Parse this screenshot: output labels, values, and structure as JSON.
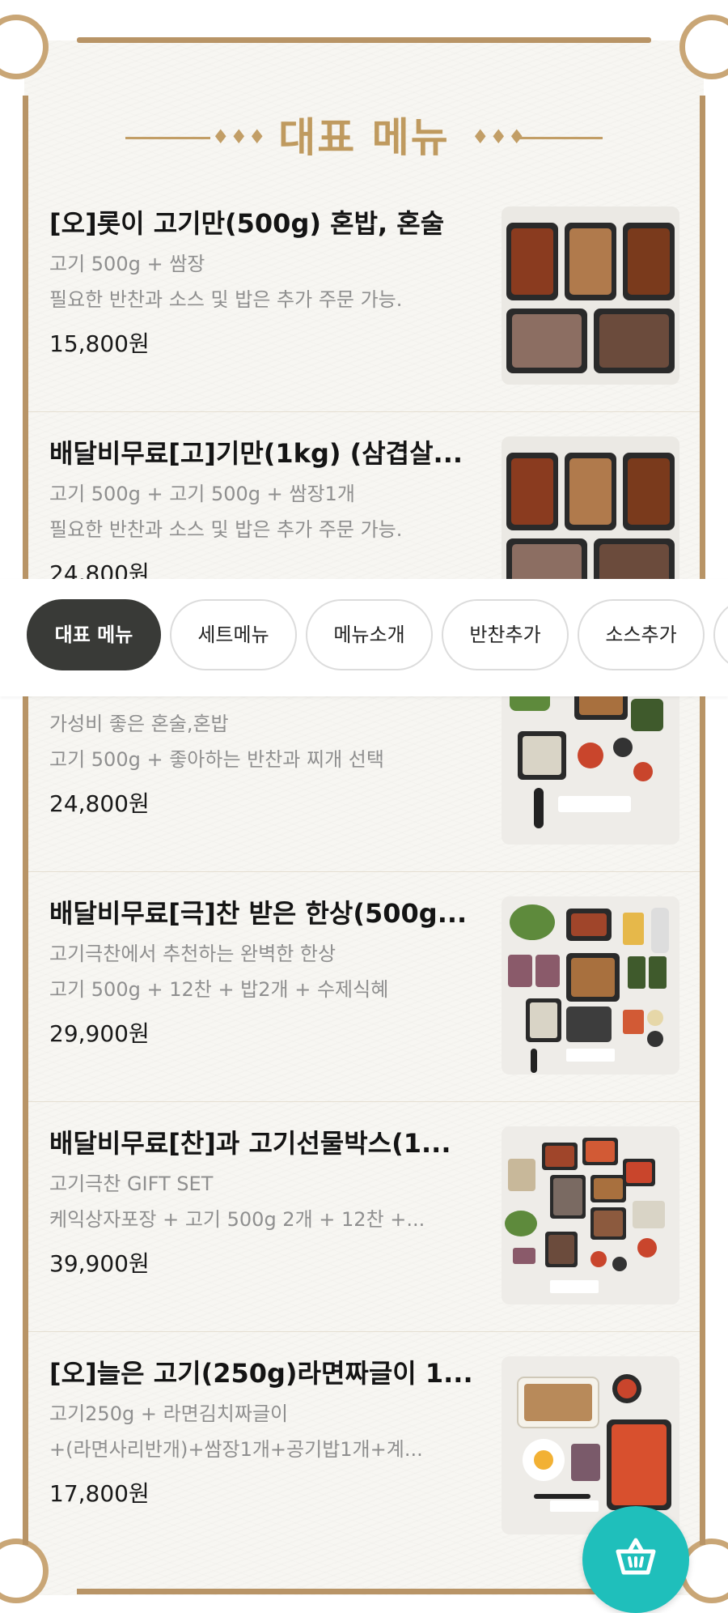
{
  "section": {
    "title": "대표 메뉴",
    "ornament": "♦♦♦"
  },
  "menu_items": [
    {
      "name": "[오]롯이 고기만(500g) 혼밥, 혼술",
      "desc1": "고기 500g + 쌈장",
      "desc2": "필요한 반찬과 소스 및 밥은 추가 주문 가능.",
      "price": "15,800원",
      "image": "five-container-meat-tray"
    },
    {
      "name": "배달비무료[고]기만(1kg) (삼겹살...",
      "desc1": "고기 500g + 고기 500g + 쌈장1개",
      "desc2": "필요한 반찬과 소스 및 밥은 추가 주문 가능.",
      "price": "24,800원",
      "image": "five-container-meat-tray"
    },
    {
      "name": "",
      "desc1": "가성비 좋은 혼술,혼밥",
      "desc2": "고기 500g + 좋아하는 반찬과 찌개 선택",
      "price": "24,800원",
      "image": "meat-with-side-dishes"
    },
    {
      "name": "배달비무료[극]찬 받은 한상(500g...",
      "desc1": "고기극찬에서 추천하는 완벽한 한상",
      "desc2": "고기 500g + 12찬 + 밥2개 + 수제식혜",
      "price": "29,900원",
      "image": "full-table-set"
    },
    {
      "name": "배달비무료[찬]과 고기선물박스(1...",
      "desc1": "고기극찬 GIFT SET",
      "desc2": "케익상자포장 + 고기 500g 2개 + 12찬 +...",
      "price": "39,900원",
      "image": "gift-box-set"
    },
    {
      "name": "[오]늘은 고기(250g)라면짜글이 1...",
      "desc1": "고기250g + 라면김치짜글이",
      "desc2": "+(라면사리반개)+쌈장1개+공기밥1개+계...",
      "price": "17,800원",
      "image": "ramen-jjageuli-set"
    }
  ],
  "tabs": [
    {
      "label": "대표 메뉴",
      "active": true
    },
    {
      "label": "세트메뉴",
      "active": false
    },
    {
      "label": "메뉴소개",
      "active": false
    },
    {
      "label": "반찬추가",
      "active": false
    },
    {
      "label": "소스추가",
      "active": false
    }
  ],
  "colors": {
    "accent_gold": "#bf9a5f",
    "active_tab": "#393a37",
    "cart_button": "#1fbfbb"
  },
  "cart": {
    "icon": "shopping-basket-icon"
  }
}
